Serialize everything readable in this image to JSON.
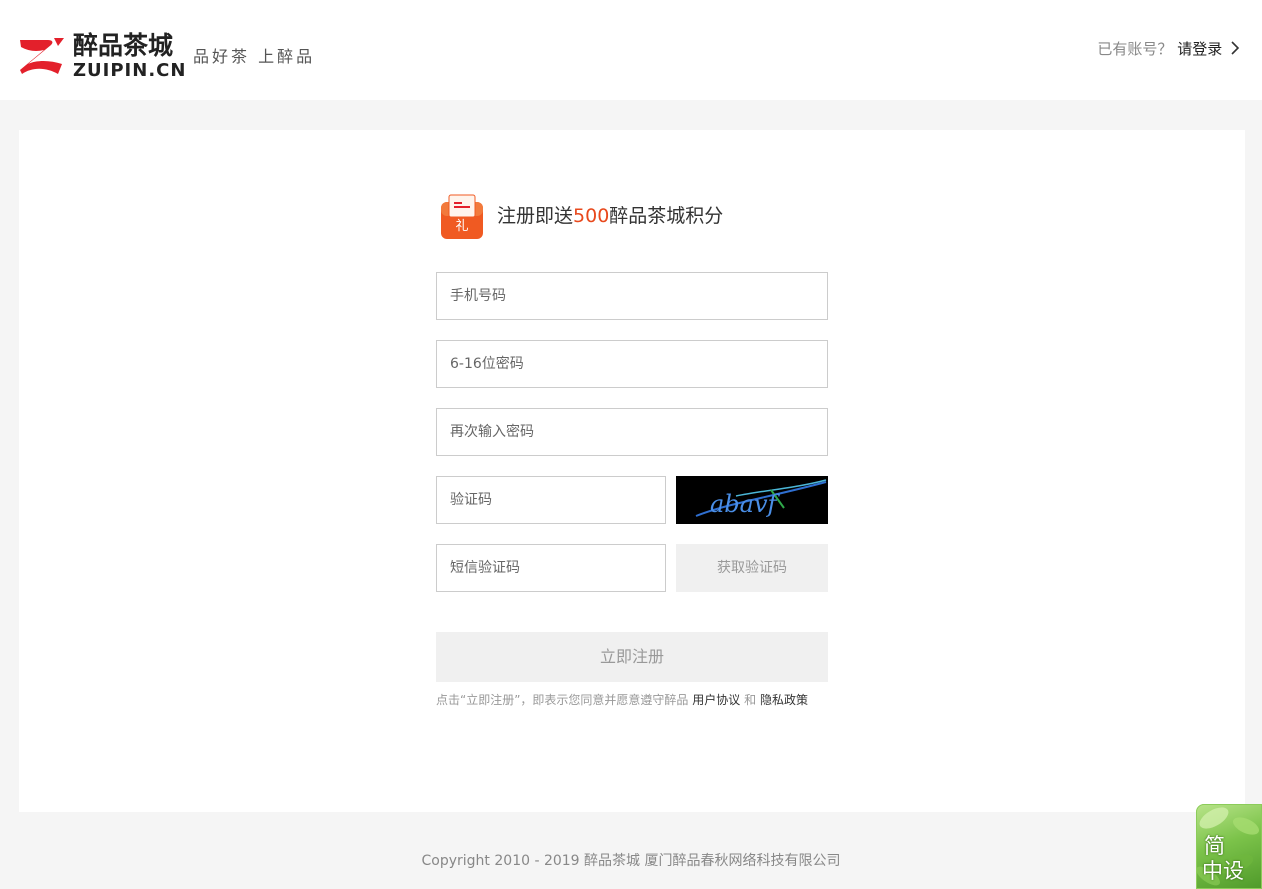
{
  "header": {
    "logo_cn": "醉品茶城",
    "logo_en": "ZUIPIN.CN",
    "slogan": "品好茶 上醉品",
    "login_prompt": "已有账号？",
    "login_link": "请登录"
  },
  "promo": {
    "gift_icon_label": "礼",
    "text_before": "注册即送",
    "highlight": "500",
    "text_after": "醉品茶城积分"
  },
  "form": {
    "phone_placeholder": "手机号码",
    "password_placeholder": "6-16位密码",
    "confirm_placeholder": "再次输入密码",
    "captcha_placeholder": "验证码",
    "captcha_text": "abavf",
    "sms_placeholder": "短信验证码",
    "sms_button": "获取验证码",
    "submit_button": "立即注册"
  },
  "agreement": {
    "prefix": "点击“立即注册”，即表示您同意并愿意遵守醉品",
    "user_agreement": "用户协议",
    "and": "和",
    "privacy_policy": "隐私政策"
  },
  "footer": {
    "copyright": "Copyright 2010 - 2019 醉品茶城 厦门醉品春秋网络科技有限公司"
  },
  "widget": {
    "line1": "简",
    "line2": "中设"
  },
  "colors": {
    "brand_red": "#e8491d",
    "logo_red": "#e3202b"
  }
}
